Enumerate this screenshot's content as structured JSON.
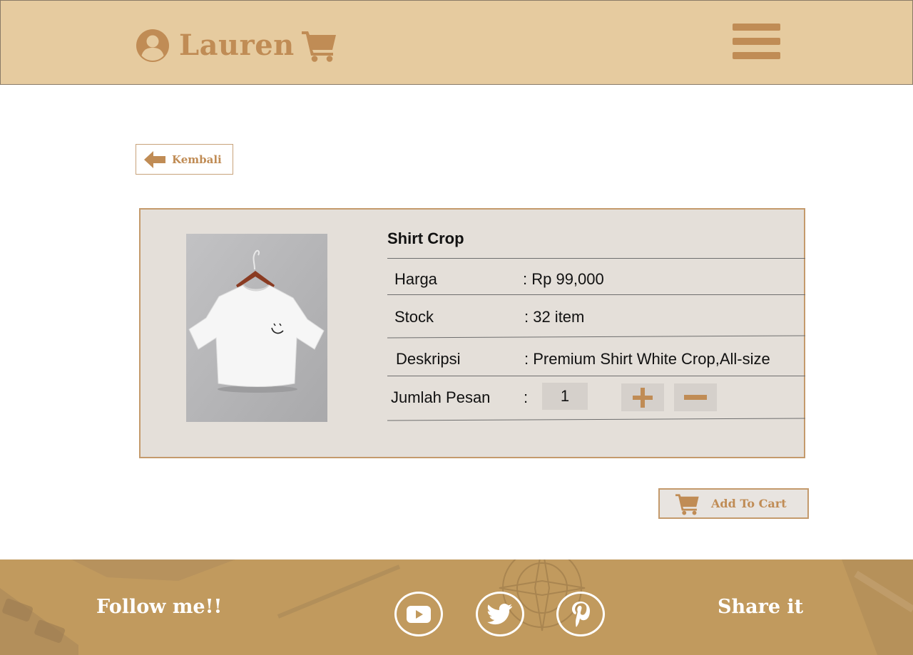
{
  "header": {
    "brand_name": "Lauren",
    "user_icon": "user-circle-icon",
    "cart_icon": "shopping-cart-icon",
    "menu_icon": "hamburger-menu-icon",
    "background_color": "#e6cb9f",
    "accent_color": "#c08c55"
  },
  "back_button": {
    "label": "Kembali",
    "icon": "arrow-left-icon"
  },
  "product": {
    "name": "Shirt Crop",
    "image_alt": "white crop t-shirt on hanger",
    "fields": [
      {
        "label": "Harga",
        "value": ": Rp 99,000"
      },
      {
        "label": "Stock",
        "value": ": 32 item"
      },
      {
        "label": "Deskripsi",
        "value": ": Premium Shirt White Crop,All-size"
      }
    ],
    "quantity": {
      "label": "Jumlah Pesan",
      "separator": ":",
      "value": "1",
      "increment_icon": "plus-icon",
      "decrement_icon": "minus-icon"
    }
  },
  "add_to_cart": {
    "label": "Add To Cart",
    "icon": "shopping-cart-icon"
  },
  "footer": {
    "follow_text": "Follow me!!",
    "share_text": "Share it",
    "social": [
      {
        "name": "youtube",
        "icon": "youtube-icon"
      },
      {
        "name": "twitter",
        "icon": "twitter-icon"
      },
      {
        "name": "pinterest",
        "icon": "pinterest-icon"
      }
    ],
    "background_color": "#c19a5e"
  }
}
